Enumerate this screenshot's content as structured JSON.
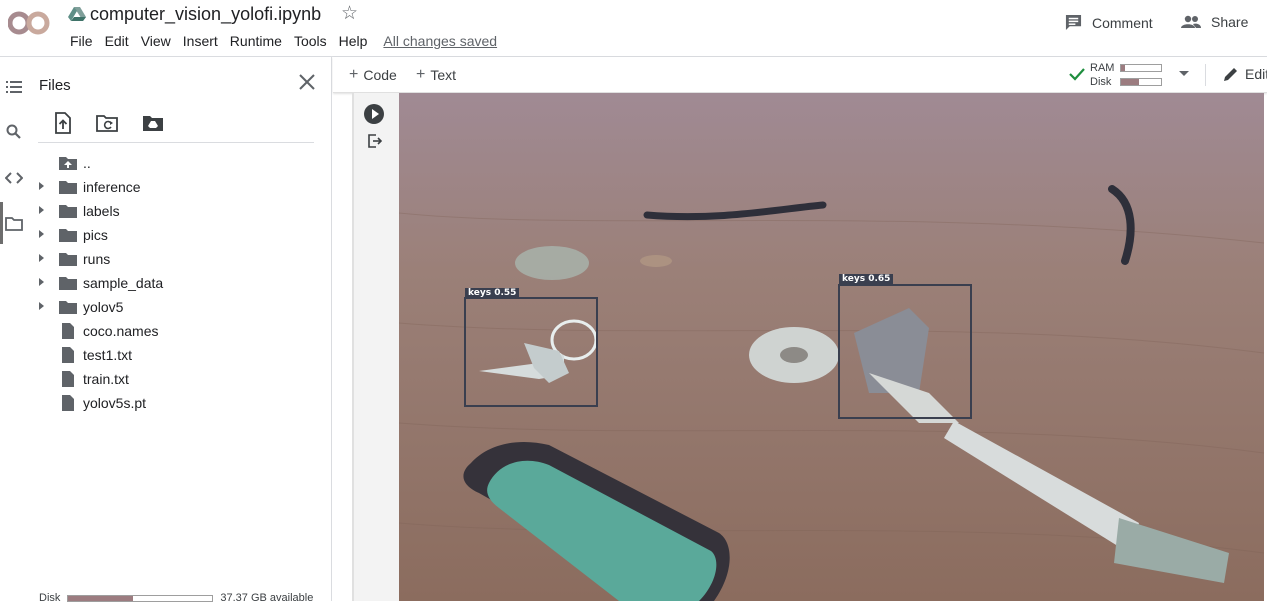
{
  "app": {
    "logo_text": "CO"
  },
  "notebook": {
    "title": "computer_vision_yolofi.ipynb"
  },
  "menu": {
    "items": [
      "File",
      "Edit",
      "View",
      "Insert",
      "Runtime",
      "Tools",
      "Help"
    ],
    "saved_status": "All changes saved"
  },
  "header_actions": {
    "comment_label": "Comment",
    "share_label": "Share"
  },
  "files_panel": {
    "title": "Files",
    "tree": [
      {
        "name": "..",
        "type": "parent"
      },
      {
        "name": "inference",
        "type": "folder"
      },
      {
        "name": "labels",
        "type": "folder"
      },
      {
        "name": "pics",
        "type": "folder"
      },
      {
        "name": "runs",
        "type": "folder"
      },
      {
        "name": "sample_data",
        "type": "folder"
      },
      {
        "name": "yolov5",
        "type": "folder"
      },
      {
        "name": "coco.names",
        "type": "file"
      },
      {
        "name": "test1.txt",
        "type": "file"
      },
      {
        "name": "train.txt",
        "type": "file"
      },
      {
        "name": "yolov5s.pt",
        "type": "file"
      }
    ],
    "disk_label": "Disk",
    "disk_available": "37.37 GB available",
    "disk_used_fraction": 0.45
  },
  "toolbar": {
    "code_label": "Code",
    "text_label": "Text",
    "ram_label": "RAM",
    "disk_label": "Disk",
    "ram_used_fraction": 0.1,
    "disk_used_fraction": 0.45,
    "edit_label": "Edit"
  },
  "output": {
    "detections": [
      {
        "label": "keys 0.55"
      },
      {
        "label": "keys 0.65"
      }
    ]
  },
  "colors": {
    "accent_check": "#1e8e3e",
    "usage_fill": "#9c7c80",
    "box_stroke": "#3a3f4f",
    "lighter_teal": "#5aa99a"
  }
}
